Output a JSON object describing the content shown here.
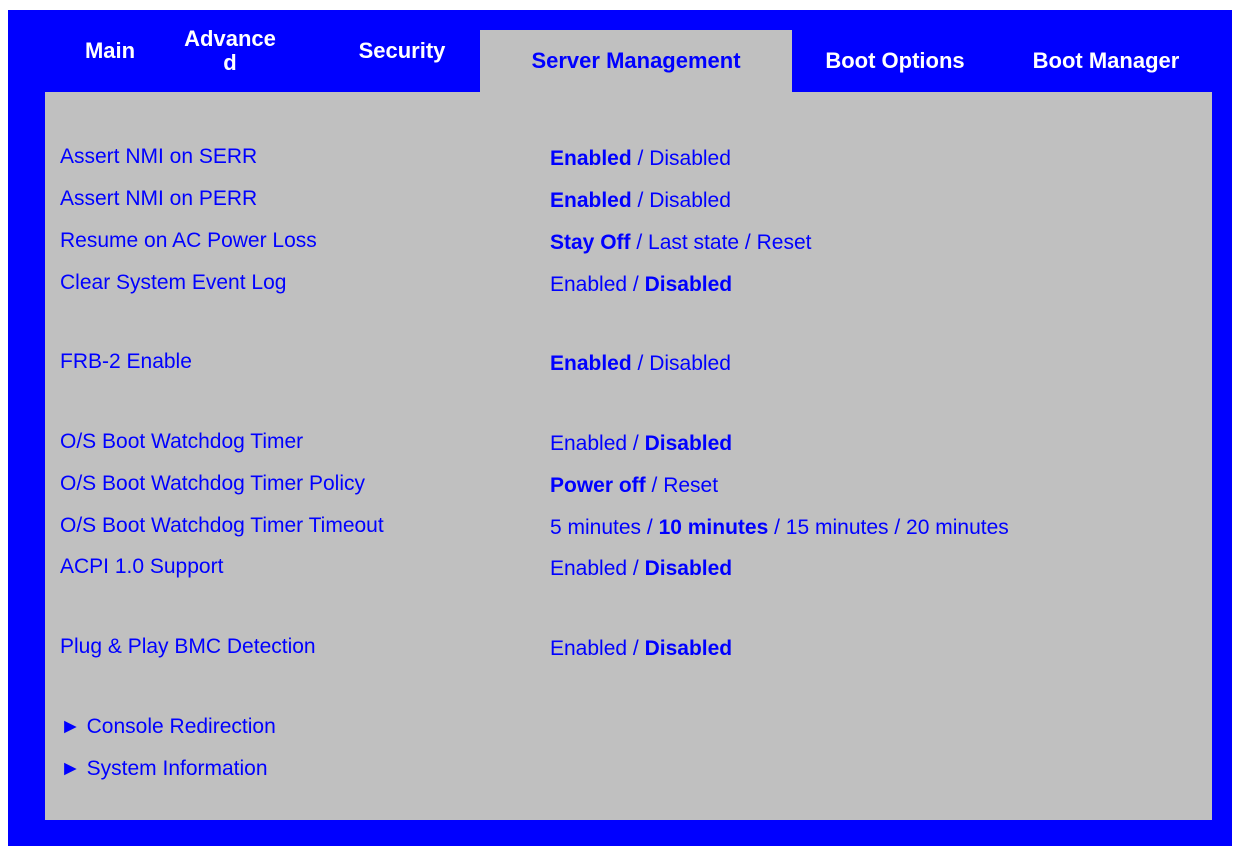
{
  "tabs": {
    "main": "Main",
    "advanced_line1": "Advance",
    "advanced_line2": "d",
    "security": "Security",
    "server_management": "Server Management",
    "boot_options": "Boot Options",
    "boot_manager": "Boot Manager",
    "active": "server_management"
  },
  "settings": [
    {
      "label": "Assert NMI on SERR",
      "options": [
        "Enabled",
        "Disabled"
      ],
      "selected": "Enabled"
    },
    {
      "label": "Assert NMI on PERR",
      "options": [
        "Enabled",
        "Disabled"
      ],
      "selected": "Enabled"
    },
    {
      "label": "Resume on AC Power Loss",
      "options": [
        "Stay Off",
        "Last state",
        "Reset"
      ],
      "selected": "Stay Off"
    },
    {
      "label": "Clear System Event Log",
      "options": [
        "Enabled",
        "Disabled"
      ],
      "selected": "Disabled"
    },
    {
      "label": "FRB-2 Enable",
      "options": [
        "Enabled",
        "Disabled"
      ],
      "selected": "Enabled"
    },
    {
      "label": "O/S Boot Watchdog Timer",
      "options": [
        "Enabled",
        "Disabled"
      ],
      "selected": "Disabled"
    },
    {
      "label": "O/S Boot Watchdog Timer Policy",
      "options": [
        "Power off",
        "Reset"
      ],
      "selected": "Power off"
    },
    {
      "label": "O/S Boot Watchdog Timer Timeout",
      "options": [
        "5 minutes",
        "10 minutes",
        "15 minutes",
        "20 minutes"
      ],
      "selected": "10 minutes"
    },
    {
      "label": "ACPI 1.0 Support",
      "options": [
        "Enabled",
        "Disabled"
      ],
      "selected": "Disabled"
    },
    {
      "label": "Plug & Play BMC Detection",
      "options": [
        "Enabled",
        "Disabled"
      ],
      "selected": "Disabled"
    }
  ],
  "submenus": [
    {
      "arrow": "►",
      "label": "Console Redirection"
    },
    {
      "arrow": "►",
      "label": "System Information"
    }
  ],
  "colors": {
    "frame": "#0000ff",
    "panel": "#c0c0c0",
    "text": "#0000ff",
    "tab_text": "#ffffff"
  }
}
